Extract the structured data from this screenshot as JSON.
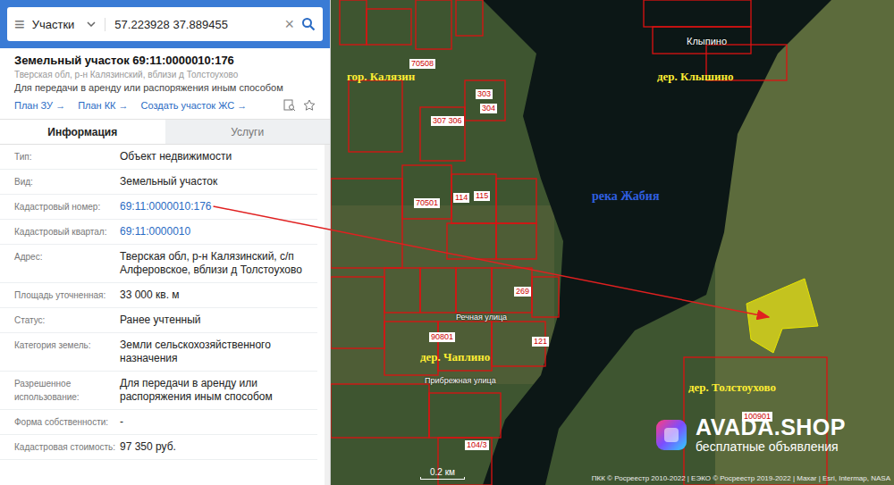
{
  "search": {
    "menu": "≡",
    "layer": "Участки",
    "query": "57.223928 37.889455",
    "clear": "×"
  },
  "card": {
    "title": "Земельный участок 69:11:0000010:176",
    "address": "Тверская обл, р-н Калязинский, вблизи д Толстоухово",
    "purpose": "Для передачи в аренду или распоряжения иным способом",
    "links": [
      "План ЗУ →",
      "План КК →",
      "Создать участок ЖС →"
    ]
  },
  "tabs": [
    {
      "label": "Информация",
      "selected": true
    },
    {
      "label": "Услуги",
      "selected": false
    }
  ],
  "rows": [
    {
      "label": "Тип:",
      "value": "Объект недвижимости",
      "link": false,
      "arrow": false
    },
    {
      "label": "Вид:",
      "value": "Земельный участок",
      "link": false,
      "arrow": false
    },
    {
      "label": "Кадастровый номер:",
      "value": "69:11:0000010:176",
      "link": true,
      "arrow": true
    },
    {
      "label": "Кадастровый квартал:",
      "value": "69:11:0000010",
      "link": true,
      "arrow": false
    },
    {
      "label": "Адрес:",
      "value": "Тверская обл, р-н Калязинский, с/п Алферовское, вблизи д Толстоухово",
      "link": false,
      "arrow": false
    },
    {
      "label": "Площадь уточненная:",
      "value": "33 000 кв. м",
      "link": false,
      "arrow": false
    },
    {
      "label": "Статус:",
      "value": "Ранее учтенный",
      "link": false,
      "arrow": false
    },
    {
      "label": "Категория земель:",
      "value": "Земли сельскохозяйственного назначения",
      "link": false,
      "arrow": false
    },
    {
      "label": "Разрешенное использование:",
      "value": "Для передачи в аренду или распоряжения иным способом",
      "link": false,
      "arrow": false
    },
    {
      "label": "Форма собственности:",
      "value": "-",
      "link": false,
      "arrow": false
    },
    {
      "label": "Кадастровая стоимость:",
      "value": "97 350 руб.",
      "link": false,
      "arrow": false
    }
  ],
  "map": {
    "labels": [
      {
        "text": "гор. Калязин",
        "kind": "settlement"
      },
      {
        "text": "дер. Клышино",
        "kind": "settlement"
      },
      {
        "text": "Клыпино",
        "kind": "village"
      },
      {
        "text": "река Жабия",
        "kind": "river"
      },
      {
        "text": "дер. Чаплино",
        "kind": "settlement"
      },
      {
        "text": "дер. Толстоухово",
        "kind": "settlement"
      },
      {
        "text": "Речная улица",
        "kind": "street"
      },
      {
        "text": "Прибрежная улица",
        "kind": "street"
      },
      {
        "text": "70508",
        "kind": "parcel"
      },
      {
        "text": "303",
        "kind": "parcel"
      },
      {
        "text": "304",
        "kind": "parcel"
      },
      {
        "text": "307 306",
        "kind": "parcel"
      },
      {
        "text": "70501",
        "kind": "parcel"
      },
      {
        "text": "114",
        "kind": "parcel"
      },
      {
        "text": "115",
        "kind": "parcel"
      },
      {
        "text": "269",
        "kind": "parcel"
      },
      {
        "text": "121",
        "kind": "parcel"
      },
      {
        "text": "90801",
        "kind": "parcel"
      },
      {
        "text": "100901",
        "kind": "parcel"
      },
      {
        "text": "104/3",
        "kind": "parcel"
      }
    ],
    "scale": "0.2 км",
    "attribution": "ПКК © Росреестр 2010-2022 | ЕЭКО © Росреестр 2019-2022 | Maxar | Esri, Intermap, NASA",
    "watermark": {
      "brand": "AVADA.SHOP",
      "tagline": "бесплатные объявления"
    }
  }
}
